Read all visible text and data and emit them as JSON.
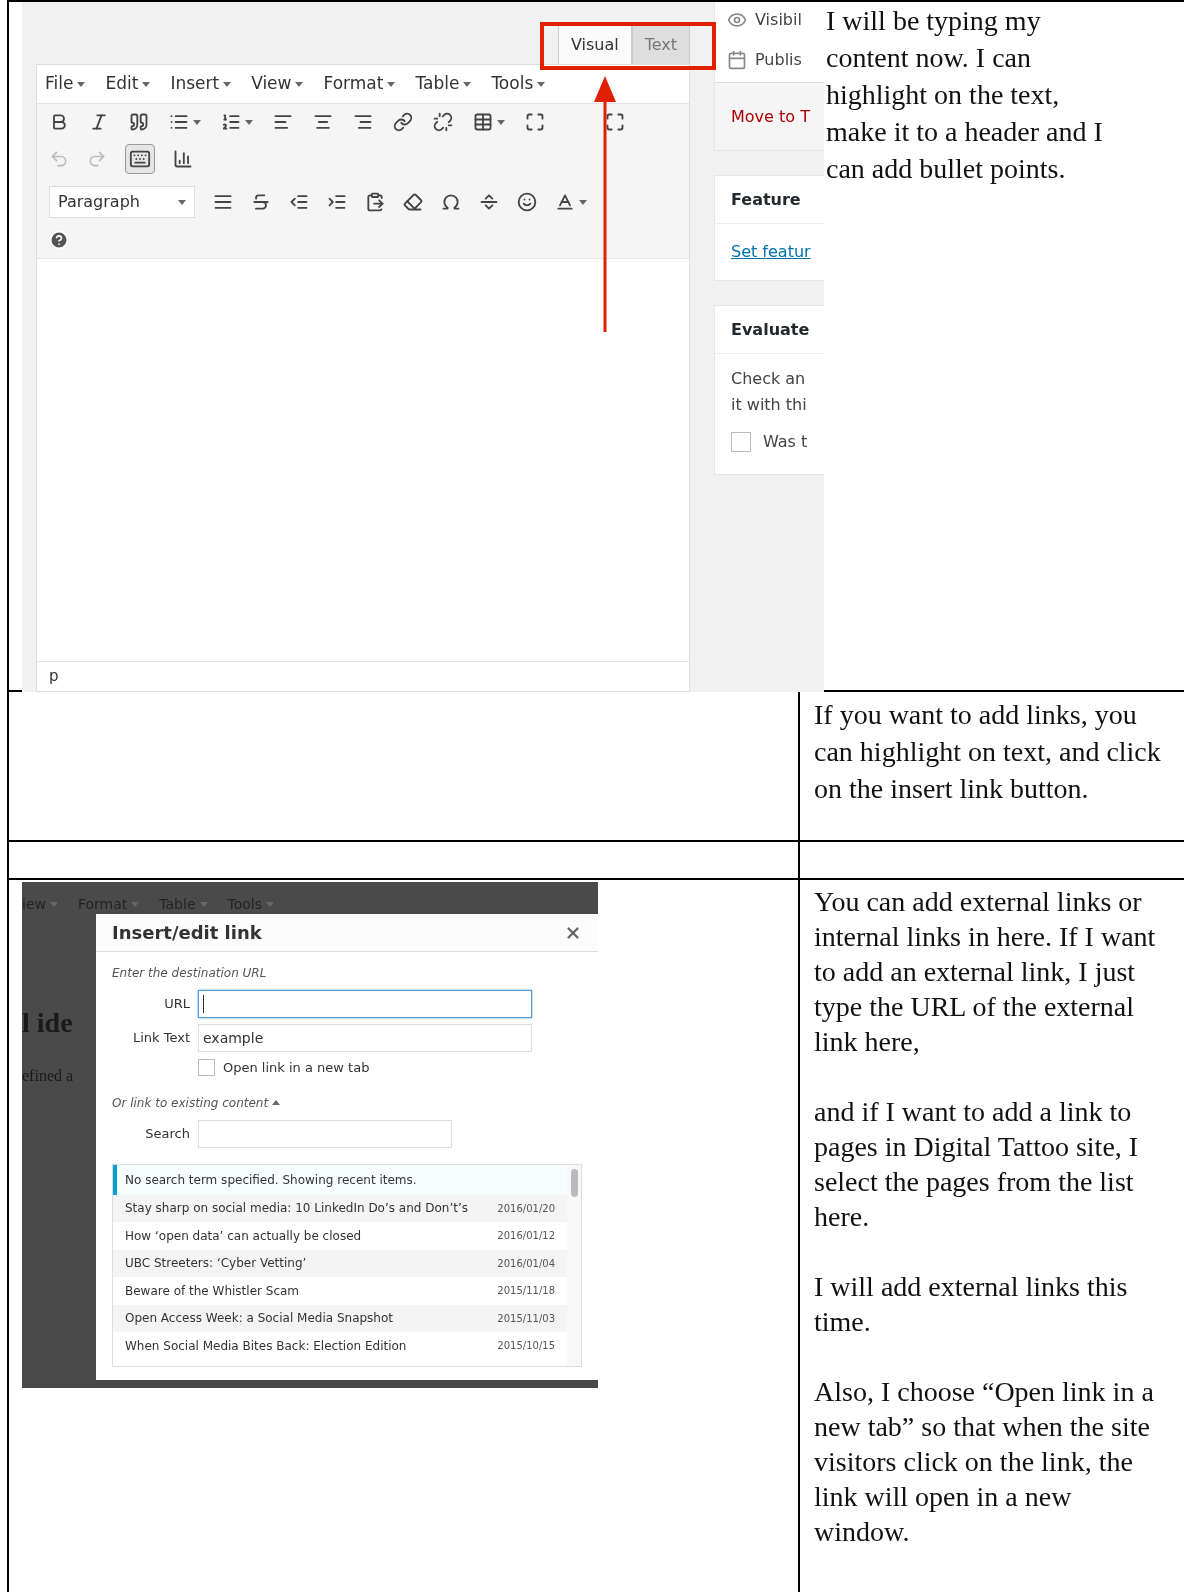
{
  "editor_screenshot": {
    "tabs": [
      {
        "label": "Visual",
        "selected": true
      },
      {
        "label": "Text",
        "selected": false
      }
    ],
    "menu": [
      "File",
      "Edit",
      "Insert",
      "View",
      "Format",
      "Table",
      "Tools"
    ],
    "format_select": "Paragraph",
    "status_path": "p",
    "sidebar": {
      "visibility": "Visibil",
      "publish": "Publis",
      "trash_link": "Move to T",
      "featured_title": "Feature",
      "featured_link": "Set featur",
      "evaluate_title": "Evaluate",
      "evaluate_lines": [
        "Check an",
        "it with thi"
      ],
      "checkbox": {
        "label": "Was t",
        "checked": false
      }
    }
  },
  "notes": {
    "row_1": "I will be typing my content now. I can highlight on the text, make it to a header and I can add bullet points.",
    "row_2": "If you want to add links, you can highlight on text, and click on the insert link button.",
    "row_4": [
      "You can add external links or internal links in here.  If I want to add an external link, I just type the URL of the external link here,",
      "and if I want to add a link to pages in Digital Tattoo site, I select the pages from the list here.",
      "I will add external links this time.",
      "Also, I choose “Open link in a new tab” so that when the site visitors click on the link, the link will open in a new window."
    ]
  },
  "link_dialog": {
    "background_menu": [
      "iew",
      "Format",
      "Table",
      "Tools"
    ],
    "background_heading": "l ide",
    "background_text": "efined a",
    "title": "Insert/edit link",
    "instruction": "Enter the destination URL",
    "url_label": "URL",
    "link_text": {
      "label": "Link Text",
      "value": "example"
    },
    "new_tab": {
      "label": "Open link in a new tab",
      "checked": false
    },
    "existing_toggle": {
      "label": "Or link to existing content",
      "expanded": true
    },
    "search_label": "Search",
    "notice": "No search term specified. Showing recent items.",
    "results": [
      {
        "title": "Stay sharp on social media: 10 LinkedIn Do’s and Don’t’s",
        "date": "2016/01/20"
      },
      {
        "title": "How ‘open data’ can actually be closed",
        "date": "2016/01/12"
      },
      {
        "title": "UBC Streeters: ‘Cyber Vetting’",
        "date": "2016/01/04"
      },
      {
        "title": "Beware of the Whistler Scam",
        "date": "2015/11/18"
      },
      {
        "title": "Open Access Week: a Social Media Snapshot",
        "date": "2015/11/03"
      },
      {
        "title": "When Social Media Bites Back: Election Edition",
        "date": "2015/10/15"
      }
    ]
  }
}
